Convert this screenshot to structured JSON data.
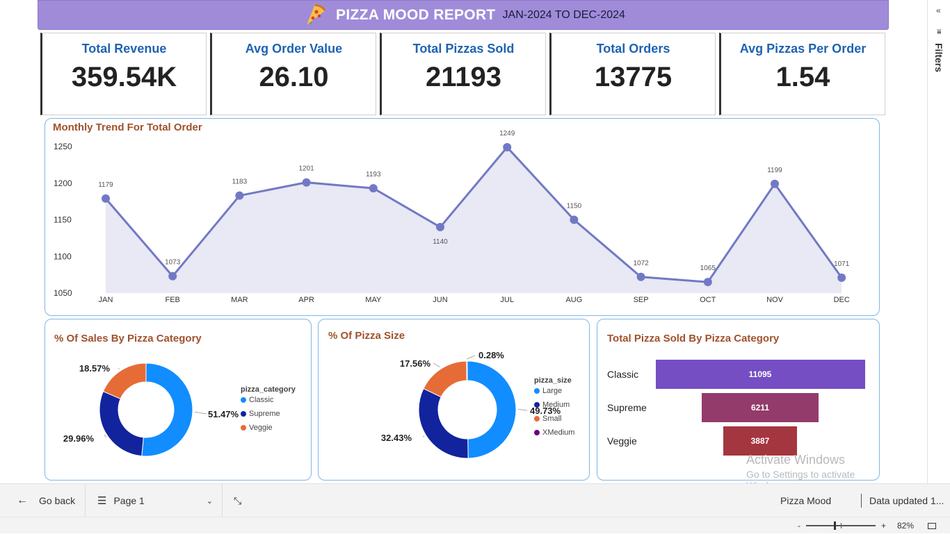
{
  "header": {
    "title": "PIZZA MOOD REPORT",
    "date_range": "JAN-2024 TO DEC-2024",
    "banner_color": "#a08bd9"
  },
  "kpis": [
    {
      "label": "Total Revenue",
      "value": "359.54K"
    },
    {
      "label": "Avg Order Value",
      "value": "26.10"
    },
    {
      "label": "Total Pizzas Sold",
      "value": "21193"
    },
    {
      "label": "Total Orders",
      "value": "13775"
    },
    {
      "label": "Avg Pizzas Per Order",
      "value": "1.54"
    }
  ],
  "chart_data": [
    {
      "type": "area",
      "title": "Monthly Trend For Total Order",
      "categories": [
        "JAN",
        "FEB",
        "MAR",
        "APR",
        "MAY",
        "JUN",
        "JUL",
        "AUG",
        "SEP",
        "OCT",
        "NOV",
        "DEC"
      ],
      "values": [
        1179,
        1073,
        1183,
        1201,
        1193,
        1140,
        1249,
        1150,
        1072,
        1065,
        1199,
        1071
      ],
      "yticks": [
        1050,
        1100,
        1150,
        1200,
        1250
      ],
      "ylim": [
        1050,
        1250
      ],
      "color": "#7279c4",
      "fill": "#e9e8f5"
    },
    {
      "type": "pie",
      "title": "% Of Sales By Pizza Category",
      "legend_title": "pizza_category",
      "labels": [
        "Classic",
        "Supreme",
        "Veggie"
      ],
      "values": [
        51.47,
        29.96,
        18.57
      ],
      "value_labels": [
        "51.47%",
        "29.96%",
        "18.57%"
      ],
      "colors": [
        "#118dff",
        "#12239e",
        "#e66c37"
      ]
    },
    {
      "type": "pie",
      "title": "% Of Pizza Size",
      "legend_title": "pizza_size",
      "labels": [
        "Large",
        "Medium",
        "Small",
        "XMedium"
      ],
      "values": [
        49.73,
        32.43,
        17.56,
        0.28
      ],
      "value_labels": [
        "49.73%",
        "32.43%",
        "17.56%",
        "0.28%"
      ],
      "colors": [
        "#118dff",
        "#12239e",
        "#e66c37",
        "#6b007b"
      ]
    },
    {
      "type": "bar",
      "title": "Total Pizza Sold By Pizza Category",
      "categories": [
        "Classic",
        "Supreme",
        "Veggie"
      ],
      "values": [
        11095,
        6211,
        3887
      ],
      "colors": [
        "#744ec2",
        "#933b6b",
        "#a4363f"
      ]
    }
  ],
  "watermark": {
    "line1": "Activate Windows",
    "line2": "Go to Settings to activate Windows."
  },
  "filters_pane": {
    "label": "Filters",
    "collapse_icon": "double-chevron-left-icon"
  },
  "bottom_bar": {
    "go_back": "Go back",
    "page": "Page 1",
    "report_name": "Pizza Mood",
    "data_updated": "Data updated 1..."
  },
  "status_bar": {
    "zoom_minus": "-",
    "zoom_plus": "+",
    "zoom_level": "82%",
    "zoom_fraction": 0.41
  }
}
